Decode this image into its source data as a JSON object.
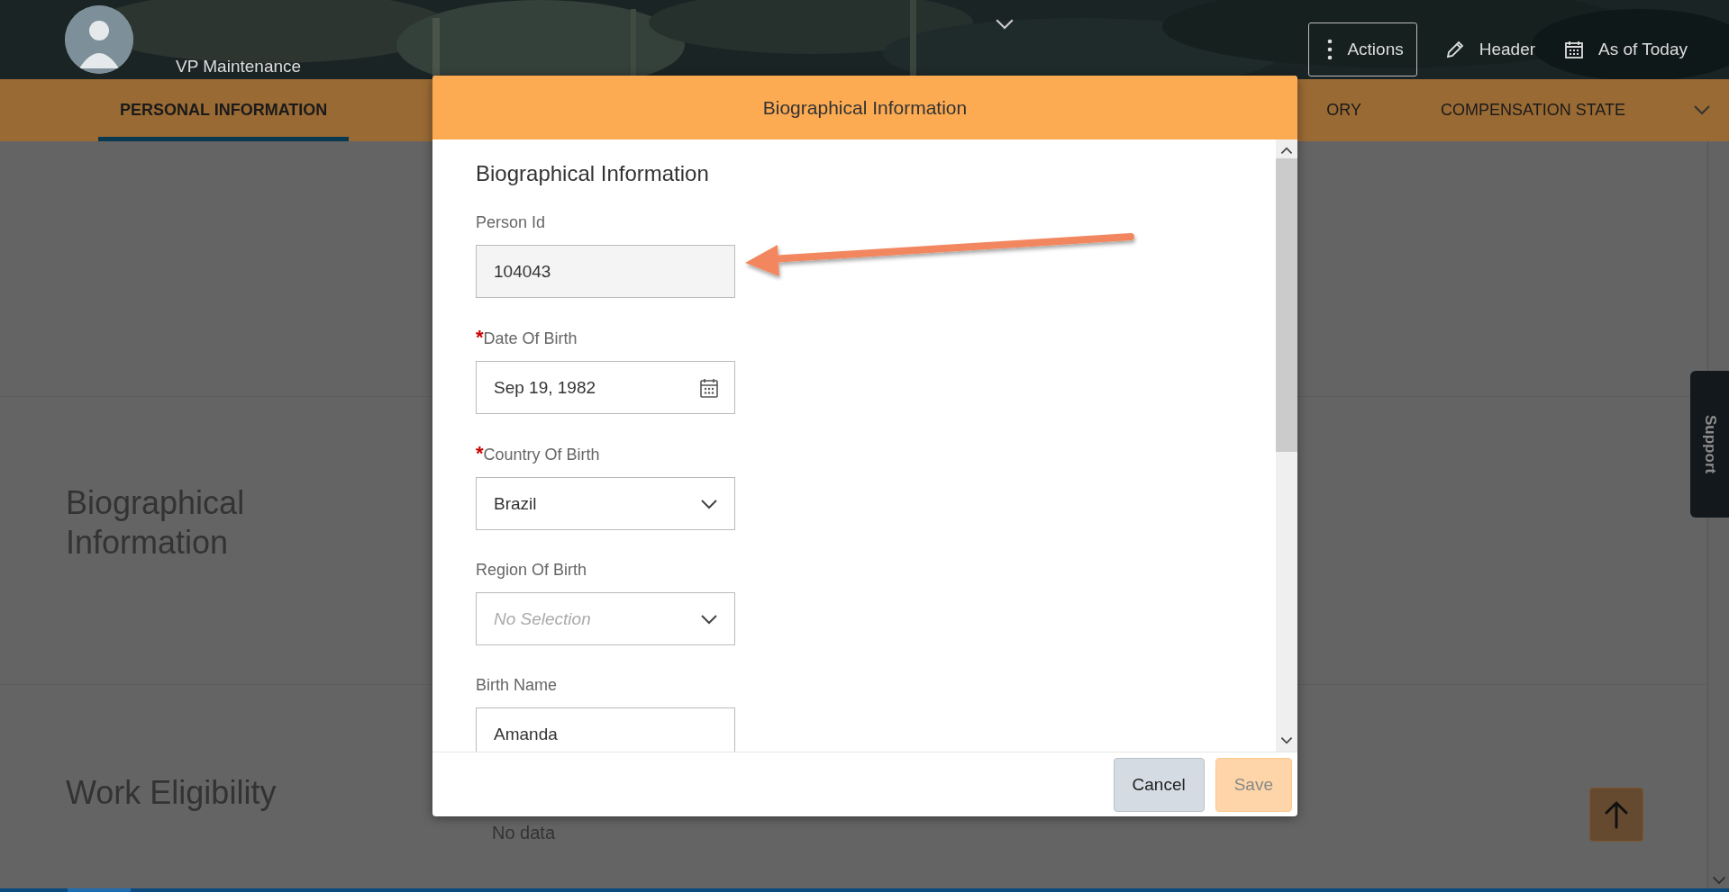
{
  "header": {
    "subtitle": "VP Maintenance",
    "actions": [
      {
        "kind": "more",
        "label": "Actions",
        "boxed": true
      },
      {
        "kind": "edit",
        "label": "Header",
        "boxed": false
      },
      {
        "kind": "calendar",
        "label": "As of Today",
        "boxed": false
      }
    ]
  },
  "tabs": [
    {
      "label": "PERSONAL INFORMATION",
      "selected": true
    },
    {
      "label": "ORY",
      "selected": false
    },
    {
      "label": "COMPENSATION STATE",
      "selected": false
    }
  ],
  "sections": [
    {
      "title": "Biographical Information"
    },
    {
      "title": "Work Eligibility",
      "note": "No data"
    }
  ],
  "support": "Support",
  "dialog": {
    "title": "Biographical Information",
    "heading": "Biographical Information",
    "fields": [
      {
        "kind": "readonly",
        "label": "Person Id",
        "value": "104043"
      },
      {
        "kind": "date",
        "mark": "*",
        "label": "Date Of Birth",
        "value": "Sep 19, 1982"
      },
      {
        "kind": "select",
        "mark": "*",
        "label": "Country Of Birth",
        "value": "Brazil"
      },
      {
        "kind": "select",
        "label": "Region Of Birth",
        "placeholder": "No Selection"
      },
      {
        "kind": "text",
        "label": "Birth Name",
        "value": "Amanda"
      }
    ],
    "buttons": [
      {
        "label": "Cancel",
        "disabled": false
      },
      {
        "label": "Save",
        "disabled": true
      }
    ]
  }
}
